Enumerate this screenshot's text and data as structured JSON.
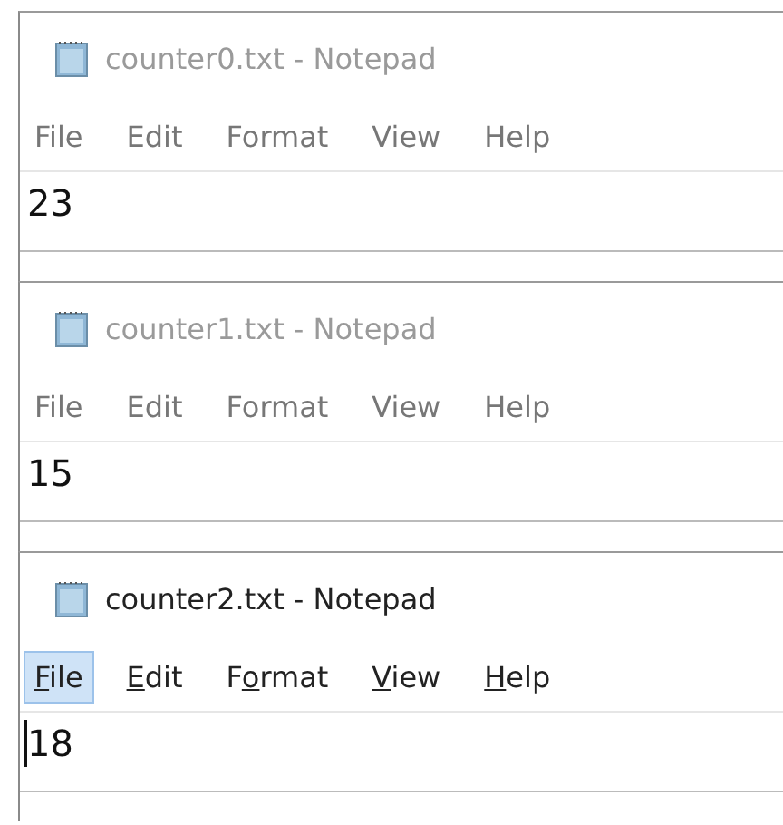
{
  "windows": [
    {
      "title": "counter0.txt - Notepad",
      "active": false,
      "access_keys_shown": false,
      "menu": [
        {
          "label": "File",
          "selected": false
        },
        {
          "label": "Edit",
          "selected": false
        },
        {
          "label": "Format",
          "selected": false
        },
        {
          "label": "View",
          "selected": false
        },
        {
          "label": "Help",
          "selected": false
        }
      ],
      "content": "23",
      "caret": false
    },
    {
      "title": "counter1.txt - Notepad",
      "active": false,
      "access_keys_shown": false,
      "menu": [
        {
          "label": "File",
          "selected": false
        },
        {
          "label": "Edit",
          "selected": false
        },
        {
          "label": "Format",
          "selected": false
        },
        {
          "label": "View",
          "selected": false
        },
        {
          "label": "Help",
          "selected": false
        }
      ],
      "content": "15",
      "caret": false
    },
    {
      "title": "counter2.txt - Notepad",
      "active": true,
      "access_keys_shown": true,
      "menu": [
        {
          "label": "File",
          "selected": true
        },
        {
          "label": "Edit",
          "selected": false
        },
        {
          "label": "Format",
          "selected": false
        },
        {
          "label": "View",
          "selected": false
        },
        {
          "label": "Help",
          "selected": false
        }
      ],
      "content": "18",
      "caret": true
    }
  ]
}
